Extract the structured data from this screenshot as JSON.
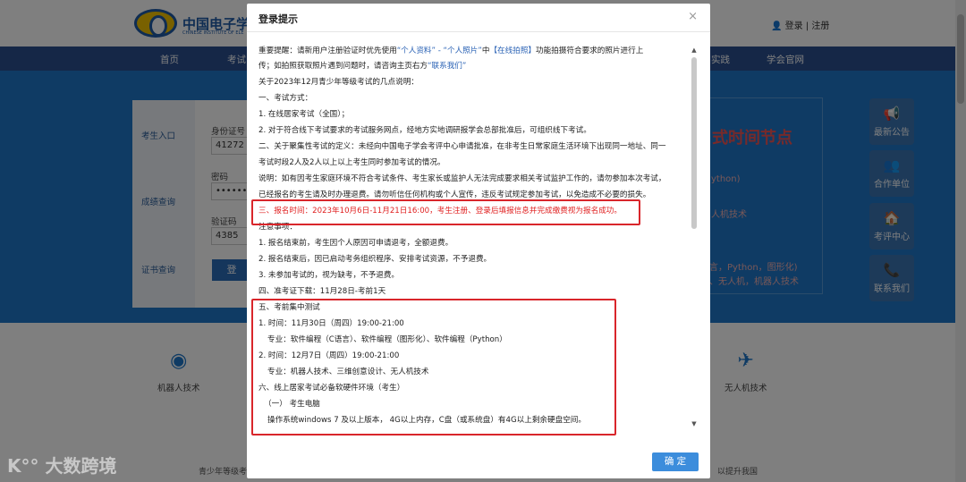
{
  "site": {
    "logo_text": "中国电子学",
    "logo_subtext": "CHINESE INSTITUTE OF ELE",
    "user_links": "👤 登录 | 注册",
    "nav": [
      "首页",
      "考试",
      "实践",
      "学会官网"
    ],
    "hero_title": "式时间节点",
    "hero_lines": [
      "ython)",
      "人机技术",
      "言，Python，图形化)",
      "、无人机，机器人技术"
    ],
    "login": {
      "tabs": [
        "考生入口",
        "成绩查询",
        "证书查询"
      ],
      "id_label": "身份证号",
      "id_value": "41272",
      "password_label": "密码",
      "password_value": "•••••••",
      "captcha_label": "验证码",
      "captcha_value": "4385",
      "submit_label": "登"
    },
    "side_buttons": [
      {
        "label": "最新公告",
        "icon": "megaphone-icon",
        "glyph": "📢"
      },
      {
        "label": "合作单位",
        "icon": "partners-icon",
        "glyph": "👥"
      },
      {
        "label": "考评中心",
        "icon": "home-icon",
        "glyph": "🏠"
      },
      {
        "label": "联系我们",
        "icon": "phone-icon",
        "glyph": "📞"
      }
    ],
    "categories": [
      "机器人技术",
      "无人机技术"
    ],
    "footer_links": [
      "青少年等级考",
      "以提升我国"
    ],
    "watermark": "大数跨境"
  },
  "modal": {
    "title": "登录提示",
    "close_glyph": "×",
    "confirm_label": "确 定",
    "notice": {
      "l1_a": "重要提醒：请新用户注册验证时优先使用",
      "l1_b": "“个人资料” - “个人照片”",
      "l1_c": "中",
      "l1_d": "【在线拍照】",
      "l1_e": "功能拍摄符合要求的照片进行上",
      "l2_a": "传；如拍照获取照片遇到问题时，请咨询主页右方",
      "l2_b": "“联系我们”"
    },
    "lines": [
      "关于2023年12月青少年等级考试的几点说明：",
      "一、考试方式：",
      "1. 在线居家考试（全国）；",
      "2. 对于符合线下考试要求的考试服务网点，经地方实地调研报学会总部批准后，可组织线下考试。",
      "二、关于聚集性考试的定义：未经向中国电子学会考评中心申请批准，在非考生日常家庭生活环境下出现同一地址、同一",
      "考试时段2人及2人以上以上考生同时参加考试的情况。",
      "说明：如有因考生家庭环境不符合考试条件、考生家长或监护人无法完成要求相关考试监护工作的，请勿参加本次考试，",
      "已经报名的考生请及时办理退费。请勿听信任何机构或个人宣传，违反考试规定参加考试，以免造成不必要的损失。",
      "三、报名时间：2023年10月6日-11月21日16:00，考生注册、登录后填报信息并完成缴费视为报名成功。",
      "注意事项：",
      "1. 报名结束前，考生因个人原因可申请退考，全额退费。",
      "2. 报名结束后，因已启动考务组织程序、安排考试资源，不予退费。",
      "3. 未参加考试的，视为缺考，不予退费。",
      "四、准考证下载：11月28日-考前1天",
      "五、考前集中测试",
      "1. 时间：11月30日（周四）19:00-21:00",
      "专业：软件编程（C语言）、软件编程（图形化）、软件编程（Python）",
      "2. 时间：12月7日（周四）19:00-21:00",
      "专业：机器人技术、三维创意设计、无人机技术",
      "六、线上居家考试必备软硬件环境（考生）",
      "（一） 考生电脑",
      "操作系统windows 7 及以上版本， 4G以上内存，C盘（或系统盘）有4G以上剩余硬盘空间。"
    ]
  }
}
